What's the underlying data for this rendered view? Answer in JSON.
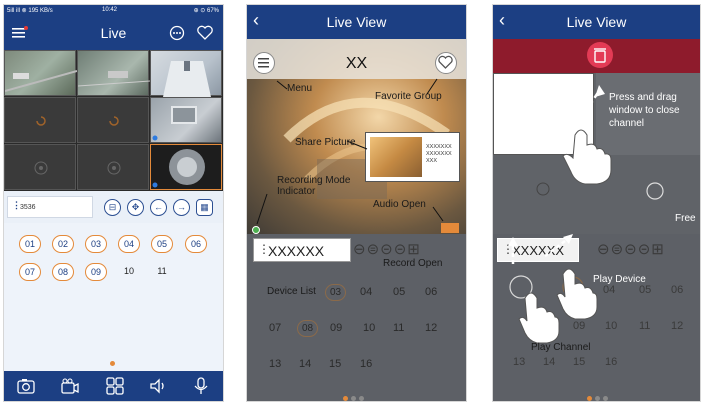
{
  "phone1": {
    "status": {
      "left": "5ill ill ⊗ 195 KB/s",
      "time": "10:42",
      "right": "⊕ ⊙ 67%"
    },
    "title": "Live",
    "device_label": "3536",
    "channels": [
      "01",
      "02",
      "03",
      "04",
      "05",
      "06",
      "07",
      "08",
      "09",
      "10",
      "11"
    ]
  },
  "phone2": {
    "title": "Live View",
    "device_name": "XX",
    "annotations": {
      "menu": "Menu",
      "favorite": "Favorite Group",
      "share": "Share Picture",
      "rec_mode": "Recording Mode\nIndicator",
      "audio": "Audio Open",
      "record": "Record Open",
      "device_list": "Device List"
    },
    "share_text": "XXXXXXX\nXXXXXXX\nXXX",
    "device_chip": "XXXXXX",
    "numbers": [
      "03",
      "04",
      "05",
      "06",
      "07",
      "08",
      "09",
      "10",
      "11",
      "12",
      "13",
      "14",
      "15",
      "16"
    ]
  },
  "phone3": {
    "title": "Live View",
    "annotations": {
      "drag_close": "Press and drag\nwindow to close\nchannel",
      "free": "Free",
      "play_device": "Play Device",
      "play_channel": "Play Channel"
    },
    "device_chip": "XXXXXX",
    "numbers": [
      "04",
      "05",
      "06",
      "09",
      "10",
      "11",
      "12",
      "13",
      "14",
      "15",
      "16"
    ]
  }
}
